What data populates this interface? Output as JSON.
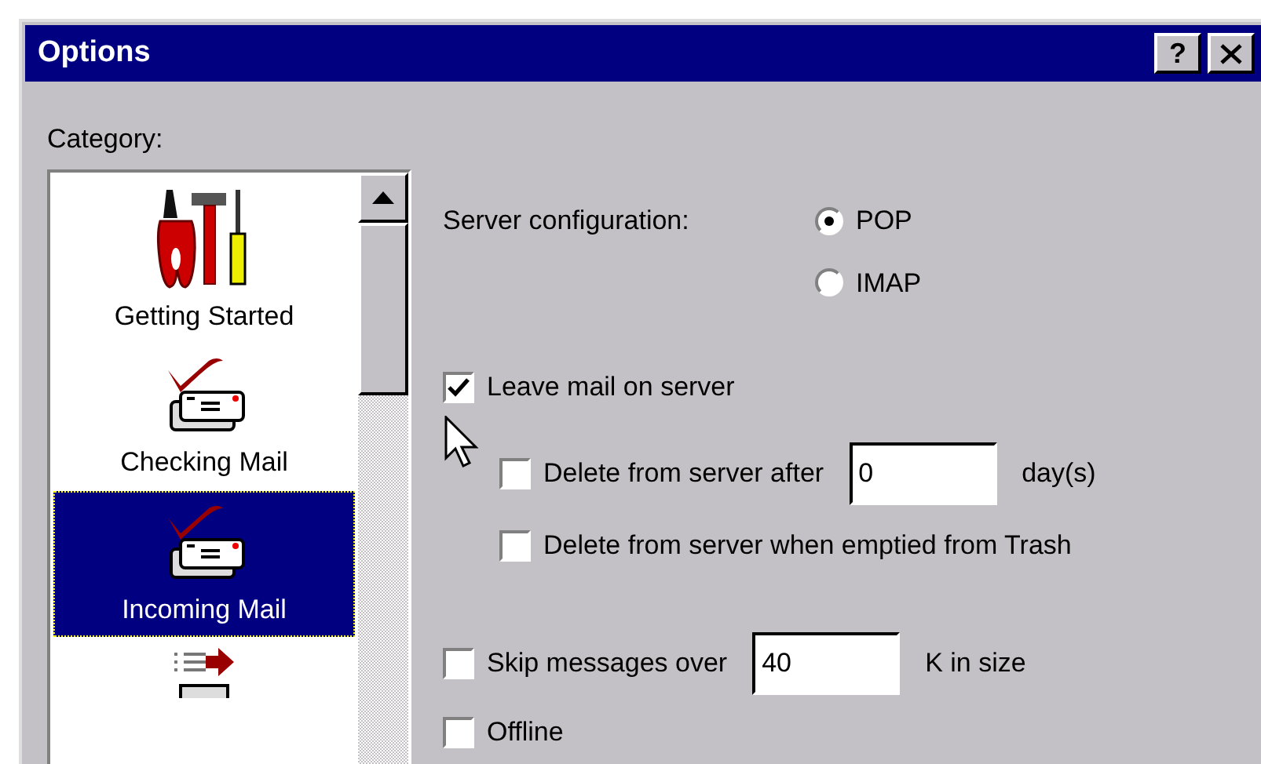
{
  "window": {
    "title": "Options",
    "title_buttons": [
      {
        "kind": "help",
        "label": "?"
      },
      {
        "kind": "close"
      }
    ]
  },
  "category": {
    "label": "Category:",
    "items": [
      {
        "label": "Getting Started",
        "kind": "tools",
        "selected": false
      },
      {
        "label": "Checking Mail",
        "kind": "mail",
        "selected": false
      },
      {
        "label": "Incoming Mail",
        "kind": "mail",
        "selected": true
      },
      {
        "kind": "send",
        "selected": false
      }
    ]
  },
  "server_configuration": {
    "label": "Server configuration:",
    "options": [
      {
        "label": "POP",
        "selected": true
      },
      {
        "label": "IMAP",
        "selected": false
      }
    ]
  },
  "settings": [
    {
      "label": "Leave mail on server",
      "checked": true,
      "children": [
        {
          "label": "Delete from server after",
          "checked": false,
          "field": {
            "value": "0"
          },
          "suffix": "day(s)"
        },
        {
          "label": "Delete from server when emptied from Trash",
          "checked": false
        }
      ]
    },
    {
      "label": "Skip messages over",
      "checked": false,
      "field": {
        "value": "40"
      },
      "suffix": "K in size"
    },
    {
      "label": "Offline",
      "checked": false
    }
  ]
}
